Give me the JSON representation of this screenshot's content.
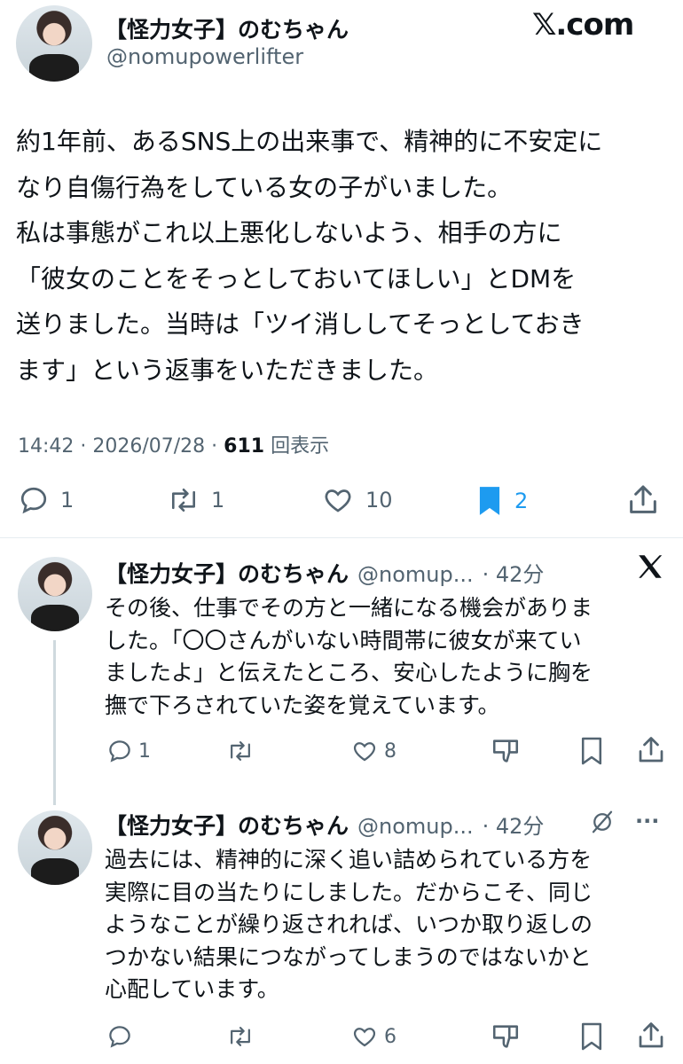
{
  "main_tweet": {
    "author_name": "【怪力女子】のむちゃん",
    "author_handle": "@nomupowerlifter",
    "site_label": "𝕏.com",
    "body_lines": [
      "約1年前、あるSNS上の出来事で、精神的に不安定に",
      "なり自傷行為をしている女の子がいました。",
      "私は事態がこれ以上悪化しないよう、相手の方に",
      "「彼女のことをそっとしておいてほしい」とDMを",
      "送りました。当時は「ツイ消ししてそっとしておき",
      "ます」という返事をいただきました。"
    ],
    "timestamp": "14:42 · 2026/07/28 · ",
    "views_count": "611",
    "views_label": " 回表示",
    "replies": "1",
    "retweets": "1",
    "likes": "10",
    "bookmarks": "2",
    "accent_color": "#1d9bf0"
  },
  "replies": [
    {
      "author_name": "【怪力女子】のむちゃん",
      "author_handle": "@nomup...",
      "time": "· 42分",
      "badge_icon": "x-logo-icon",
      "body_lines": [
        "その後、仕事でその方と一緒になる機会がありま",
        "した。「〇〇さんがいない時間帯に彼女が来てい",
        "ましたよ」と伝えたところ、安心したように胸を",
        "撫で下ろされていた姿を覚えています。"
      ],
      "reply_count": "1",
      "retweet_count": "",
      "like_count": "8"
    },
    {
      "author_name": "【怪力女子】のむちゃん",
      "author_handle": "@nomup...",
      "time": "· 42分",
      "badge_icon": "grok-icon",
      "more_label": "···",
      "body_lines": [
        "過去には、精神的に深く追い詰められている方を",
        "実際に目の当たりにしました。だからこそ、同じ",
        "ようなことが繰り返されれば、いつか取り返しの",
        "つかない結果につながってしまうのではないかと",
        "心配しています。"
      ],
      "reply_count": "",
      "retweet_count": "",
      "like_count": "6"
    }
  ]
}
